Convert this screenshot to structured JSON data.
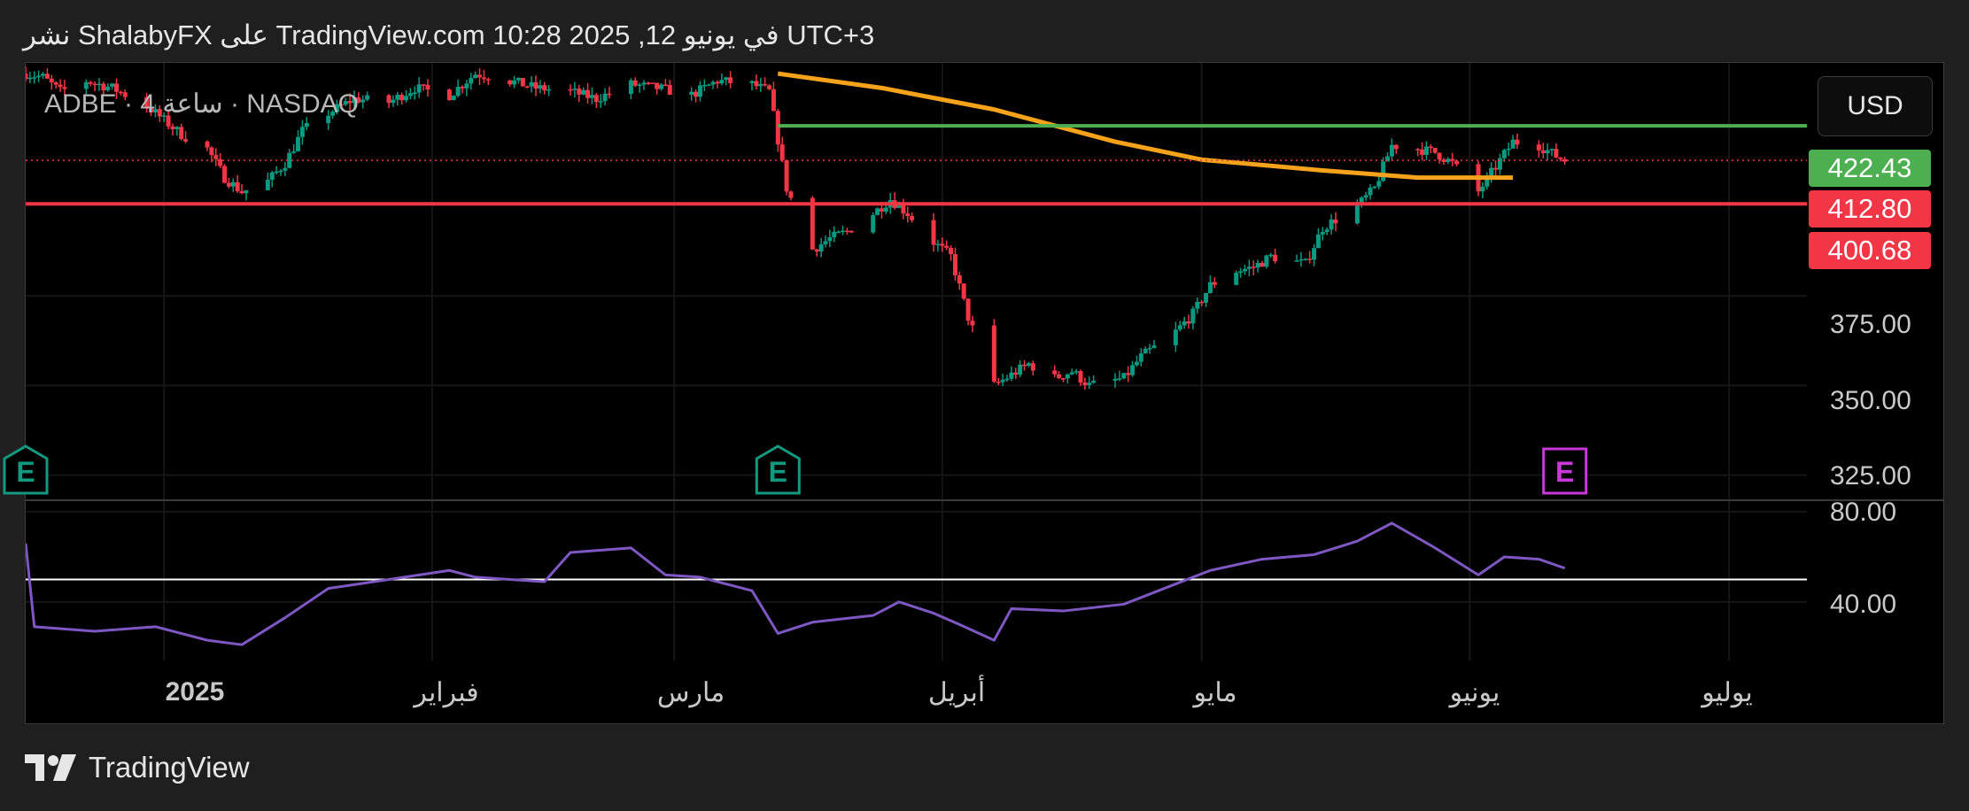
{
  "header": {
    "publish_text": "نشر ShalabyFX على TradingView.com في يونيو 12, 2025 10:28 UTC+3"
  },
  "symbol": {
    "label": "ADBE · 4 ساعة · NASDAQ"
  },
  "currency": {
    "label": "USD"
  },
  "price_labels": [
    {
      "text": "422.43",
      "color": "#4caf50"
    },
    {
      "text": "412.80",
      "color": "#f23645"
    },
    {
      "text": "400.68",
      "color": "#f23645"
    }
  ],
  "footer": {
    "brand": "TradingView",
    "brand_icon": "tradingview-logo-icon"
  },
  "chart_data": [
    {
      "type": "candlestick",
      "ylim": [
        318,
        440
      ],
      "y_ticks": [
        "375.00",
        "350.00",
        "325.00"
      ],
      "x_tick_labels": [
        "2025",
        "فبراير",
        "مارس",
        "أبريل",
        "مايو",
        "يونيو",
        "يوليو"
      ],
      "x_range": [
        "2024-12-16",
        "2025-07-10"
      ],
      "x_tick_dates": [
        "2025-01-01",
        "2025-02-01",
        "2025-03-01",
        "2025-04-01",
        "2025-05-01",
        "2025-06-01",
        "2025-07-01"
      ],
      "close_points": [
        [
          "2024-12-16",
          437
        ],
        [
          "2024-12-18",
          436
        ],
        [
          "2024-12-20",
          432
        ],
        [
          "2024-12-23",
          435
        ],
        [
          "2024-12-26",
          433
        ],
        [
          "2024-12-30",
          428
        ],
        [
          "2025-01-03",
          420
        ],
        [
          "2025-01-06",
          416
        ],
        [
          "2025-01-08",
          408
        ],
        [
          "2025-01-10",
          404
        ],
        [
          "2025-01-13",
          407
        ],
        [
          "2025-01-15",
          412
        ],
        [
          "2025-01-17",
          421
        ],
        [
          "2025-01-20",
          426
        ],
        [
          "2025-01-23",
          430
        ],
        [
          "2025-01-27",
          429
        ],
        [
          "2025-01-30",
          433
        ],
        [
          "2025-02-03",
          431
        ],
        [
          "2025-02-06",
          437
        ],
        [
          "2025-02-10",
          435
        ],
        [
          "2025-02-13",
          433
        ],
        [
          "2025-02-17",
          432
        ],
        [
          "2025-02-20",
          430
        ],
        [
          "2025-02-24",
          434
        ],
        [
          "2025-02-27",
          433
        ],
        [
          "2025-03-03",
          431
        ],
        [
          "2025-03-06",
          435
        ],
        [
          "2025-03-10",
          434
        ],
        [
          "2025-03-12",
          432
        ],
        [
          "2025-03-14",
          405
        ],
        [
          "2025-03-17",
          388
        ],
        [
          "2025-03-19",
          391
        ],
        [
          "2025-03-21",
          393
        ],
        [
          "2025-03-24",
          398
        ],
        [
          "2025-03-26",
          402
        ],
        [
          "2025-03-28",
          398
        ],
        [
          "2025-03-31",
          390
        ],
        [
          "2025-04-02",
          386
        ],
        [
          "2025-04-04",
          369
        ],
        [
          "2025-04-07",
          350
        ],
        [
          "2025-04-09",
          353
        ],
        [
          "2025-04-11",
          356
        ],
        [
          "2025-04-14",
          352
        ],
        [
          "2025-04-16",
          354
        ],
        [
          "2025-04-18",
          350
        ],
        [
          "2025-04-22",
          352
        ],
        [
          "2025-04-24",
          358
        ],
        [
          "2025-04-28",
          365
        ],
        [
          "2025-04-30",
          370
        ],
        [
          "2025-05-02",
          378
        ],
        [
          "2025-05-05",
          382
        ],
        [
          "2025-05-07",
          383
        ],
        [
          "2025-05-09",
          386
        ],
        [
          "2025-05-13",
          384
        ],
        [
          "2025-05-15",
          394
        ],
        [
          "2025-05-19",
          400
        ],
        [
          "2025-05-21",
          405
        ],
        [
          "2025-05-23",
          417
        ],
        [
          "2025-05-26",
          416
        ],
        [
          "2025-05-28",
          415
        ],
        [
          "2025-05-30",
          412
        ],
        [
          "2025-06-02",
          404
        ],
        [
          "2025-06-04",
          411
        ],
        [
          "2025-06-06",
          418
        ],
        [
          "2025-06-09",
          417
        ],
        [
          "2025-06-11",
          414
        ],
        [
          "2025-06-12",
          412.8
        ]
      ],
      "moving_average": {
        "color": "#f7a21b",
        "points": [
          [
            "2025-03-13",
            437
          ],
          [
            "2025-03-25",
            433
          ],
          [
            "2025-04-07",
            427
          ],
          [
            "2025-04-21",
            418
          ],
          [
            "2025-05-01",
            413
          ],
          [
            "2025-05-15",
            410
          ],
          [
            "2025-05-26",
            408
          ],
          [
            "2025-06-02",
            408
          ],
          [
            "2025-06-06",
            408
          ]
        ]
      },
      "levels": [
        {
          "name": "resistance",
          "value": 422.43,
          "color": "#4caf50",
          "from": "2025-03-13"
        },
        {
          "name": "last-price",
          "value": 412.8,
          "color": "#f23645",
          "dotted": true
        },
        {
          "name": "support",
          "value": 400.68,
          "color": "#f23645"
        }
      ],
      "events": [
        {
          "label": "E",
          "date": "2024-12-16",
          "color": "#129980"
        },
        {
          "label": "E",
          "date": "2025-03-13",
          "color": "#129980"
        },
        {
          "label": "E",
          "date": "2025-06-12",
          "color": "#c837d9"
        }
      ]
    },
    {
      "type": "line",
      "title": "RSI",
      "ylim": [
        14,
        84
      ],
      "y_ticks": [
        "80.00",
        "40.00"
      ],
      "reference_line": 50,
      "series_color": "#7e57c2",
      "points": [
        [
          "2024-12-16",
          66
        ],
        [
          "2024-12-17",
          29
        ],
        [
          "2024-12-24",
          27
        ],
        [
          "2024-12-31",
          29
        ],
        [
          "2025-01-06",
          23
        ],
        [
          "2025-01-10",
          21
        ],
        [
          "2025-01-15",
          33
        ],
        [
          "2025-01-20",
          46
        ],
        [
          "2025-01-27",
          50
        ],
        [
          "2025-02-03",
          54
        ],
        [
          "2025-02-06",
          51
        ],
        [
          "2025-02-10",
          50
        ],
        [
          "2025-02-14",
          49
        ],
        [
          "2025-02-17",
          62
        ],
        [
          "2025-02-24",
          64
        ],
        [
          "2025-02-28",
          52
        ],
        [
          "2025-03-04",
          51
        ],
        [
          "2025-03-10",
          45
        ],
        [
          "2025-03-13",
          26
        ],
        [
          "2025-03-17",
          31
        ],
        [
          "2025-03-24",
          34
        ],
        [
          "2025-03-27",
          40
        ],
        [
          "2025-03-31",
          35
        ],
        [
          "2025-04-03",
          30
        ],
        [
          "2025-04-07",
          23
        ],
        [
          "2025-04-09",
          37
        ],
        [
          "2025-04-15",
          36
        ],
        [
          "2025-04-22",
          39
        ],
        [
          "2025-04-28",
          48
        ],
        [
          "2025-05-02",
          54
        ],
        [
          "2025-05-08",
          59
        ],
        [
          "2025-05-14",
          61
        ],
        [
          "2025-05-19",
          67
        ],
        [
          "2025-05-23",
          75
        ],
        [
          "2025-05-28",
          64
        ],
        [
          "2025-06-02",
          52
        ],
        [
          "2025-06-05",
          60
        ],
        [
          "2025-06-09",
          59
        ],
        [
          "2025-06-12",
          55
        ]
      ]
    }
  ]
}
